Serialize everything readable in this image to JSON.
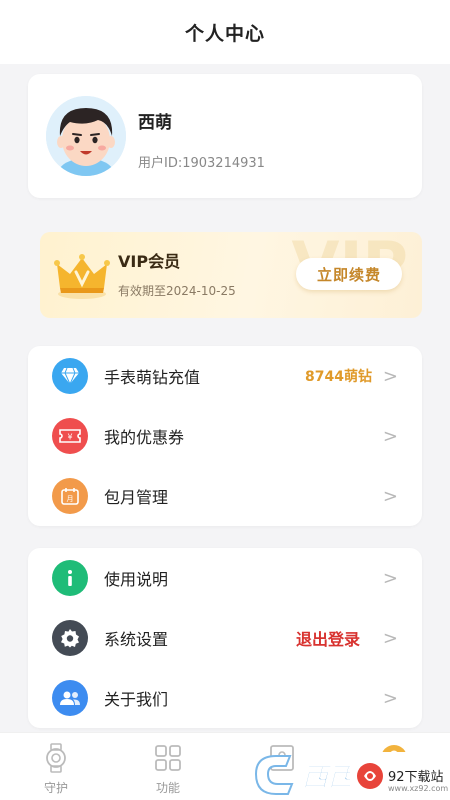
{
  "header": {
    "title": "个人中心"
  },
  "profile": {
    "name": "西萌",
    "user_id": "用户ID:1903214931",
    "avatar_icon": "boy-avatar-icon"
  },
  "vip": {
    "title": "VIP会员",
    "expiry": "有效期至2024-10-25",
    "renew_label": "立即续费",
    "watermark": "VIP",
    "crown_icon": "crown-icon"
  },
  "menu_group_1": [
    {
      "label": "手表萌钻充值",
      "value": "8744萌钻",
      "icon": "diamond-icon",
      "color": "#3aa7f0"
    },
    {
      "label": "我的优惠券",
      "value": "",
      "icon": "coupon-icon",
      "color": "#ef4e4e"
    },
    {
      "label": "包月管理",
      "value": "",
      "icon": "calendar-icon",
      "color": "#f29a4a"
    }
  ],
  "menu_group_2": [
    {
      "label": "使用说明",
      "icon": "info-icon",
      "color": "#1fbc78"
    },
    {
      "label": "系统设置",
      "icon": "gear-icon",
      "color": "#444b55",
      "action": "退出登录"
    },
    {
      "label": "关于我们",
      "icon": "users-icon",
      "color": "#3d8cf0"
    }
  ],
  "chevron": ">",
  "tabbar": [
    {
      "label": "守护",
      "icon": "watch-icon"
    },
    {
      "label": "功能",
      "icon": "grid-icon"
    },
    {
      "label": "",
      "icon": "image-icon"
    },
    {
      "label": "",
      "icon": "profile-icon"
    }
  ],
  "watermark": {
    "left_text": "西西",
    "site_title": "92下载站",
    "site_url": "www.xz92.com"
  },
  "colors": {
    "accent_orange": "#e09a2a",
    "logout_red": "#d8322f",
    "vip_gold": "#c5872a"
  }
}
